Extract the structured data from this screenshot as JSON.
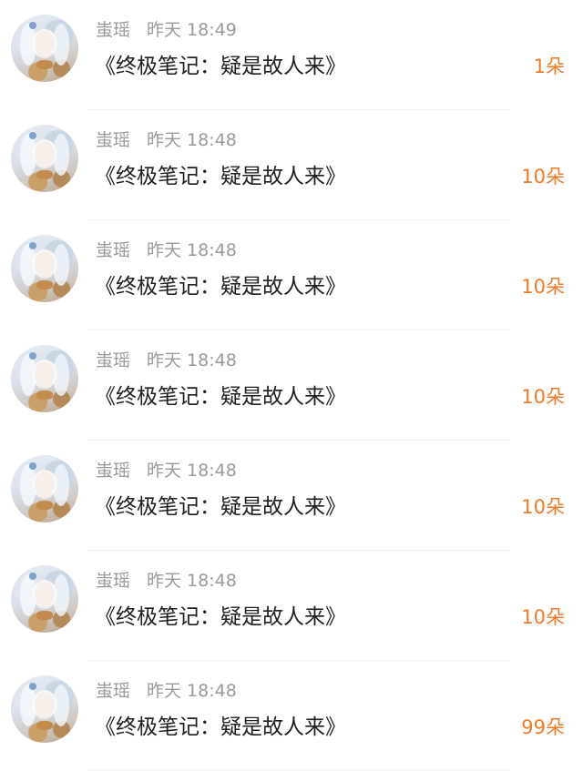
{
  "messages": [
    {
      "name": "蚩瑶",
      "time": "昨天 18:49",
      "text": "《终极笔记：疑是故人来》",
      "count": "1朵"
    },
    {
      "name": "蚩瑶",
      "time": "昨天 18:48",
      "text": "《终极笔记：疑是故人来》",
      "count": "10朵"
    },
    {
      "name": "蚩瑶",
      "time": "昨天 18:48",
      "text": "《终极笔记：疑是故人来》",
      "count": "10朵"
    },
    {
      "name": "蚩瑶",
      "time": "昨天 18:48",
      "text": "《终极笔记：疑是故人来》",
      "count": "10朵"
    },
    {
      "name": "蚩瑶",
      "time": "昨天 18:48",
      "text": "《终极笔记：疑是故人来》",
      "count": "10朵"
    },
    {
      "name": "蚩瑶",
      "time": "昨天 18:48",
      "text": "《终极笔记：疑是故人来》",
      "count": "10朵"
    },
    {
      "name": "蚩瑶",
      "time": "昨天 18:48",
      "text": "《终极笔记：疑是故人来》",
      "count": "99朵"
    }
  ],
  "colors": {
    "count": "#f07a2a",
    "name": "#9a9a9a",
    "text": "#1f1f1f",
    "divider": "#efefef"
  }
}
